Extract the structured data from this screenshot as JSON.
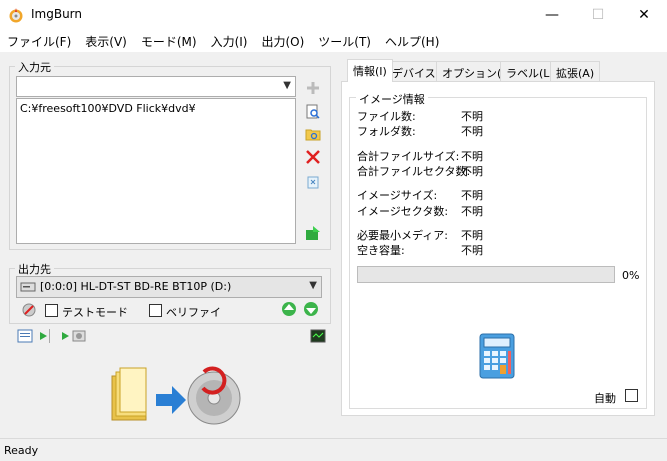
{
  "window": {
    "title": "ImgBurn",
    "minimize": "—",
    "maximize": "☐",
    "close": "✕"
  },
  "menu": [
    "ファイル(F)",
    "表示(V)",
    "モード(M)",
    "入力(I)",
    "出力(O)",
    "ツール(T)",
    "ヘルプ(H)"
  ],
  "source": {
    "label": "入力元",
    "combo_value": "",
    "files": [
      "C:¥freesoft100¥DVD Flick¥dvd¥"
    ]
  },
  "destination": {
    "label": "出力先",
    "drive": "[0:0:0] HL-DT-ST BD-RE BT10P (D:)",
    "test_mode_label": "テストモード",
    "verify_label": "ベリファイ",
    "test_mode_checked": false,
    "verify_checked": false
  },
  "tabs": [
    "情報(I)",
    "デバイス",
    "オプション(P)",
    "ラベル(L)",
    "拡張(A)"
  ],
  "info": {
    "group_label": "イメージ情報",
    "rows": [
      {
        "label": "ファイル数:",
        "value": "不明"
      },
      {
        "label": "フォルダ数:",
        "value": "不明"
      },
      {
        "label": "合計ファイルサイズ:",
        "value": "不明"
      },
      {
        "label": "合計ファイルセクタ数:",
        "value": "不明"
      },
      {
        "label": "イメージサイズ:",
        "value": "不明"
      },
      {
        "label": "イメージセクタ数:",
        "value": "不明"
      },
      {
        "label": "必要最小メディア:",
        "value": "不明"
      },
      {
        "label": "空き容量:",
        "value": "不明"
      }
    ],
    "progress_percent": 0,
    "progress_label": "0%",
    "auto_label": "自動",
    "auto_checked": false
  },
  "status": {
    "text": "Ready"
  }
}
